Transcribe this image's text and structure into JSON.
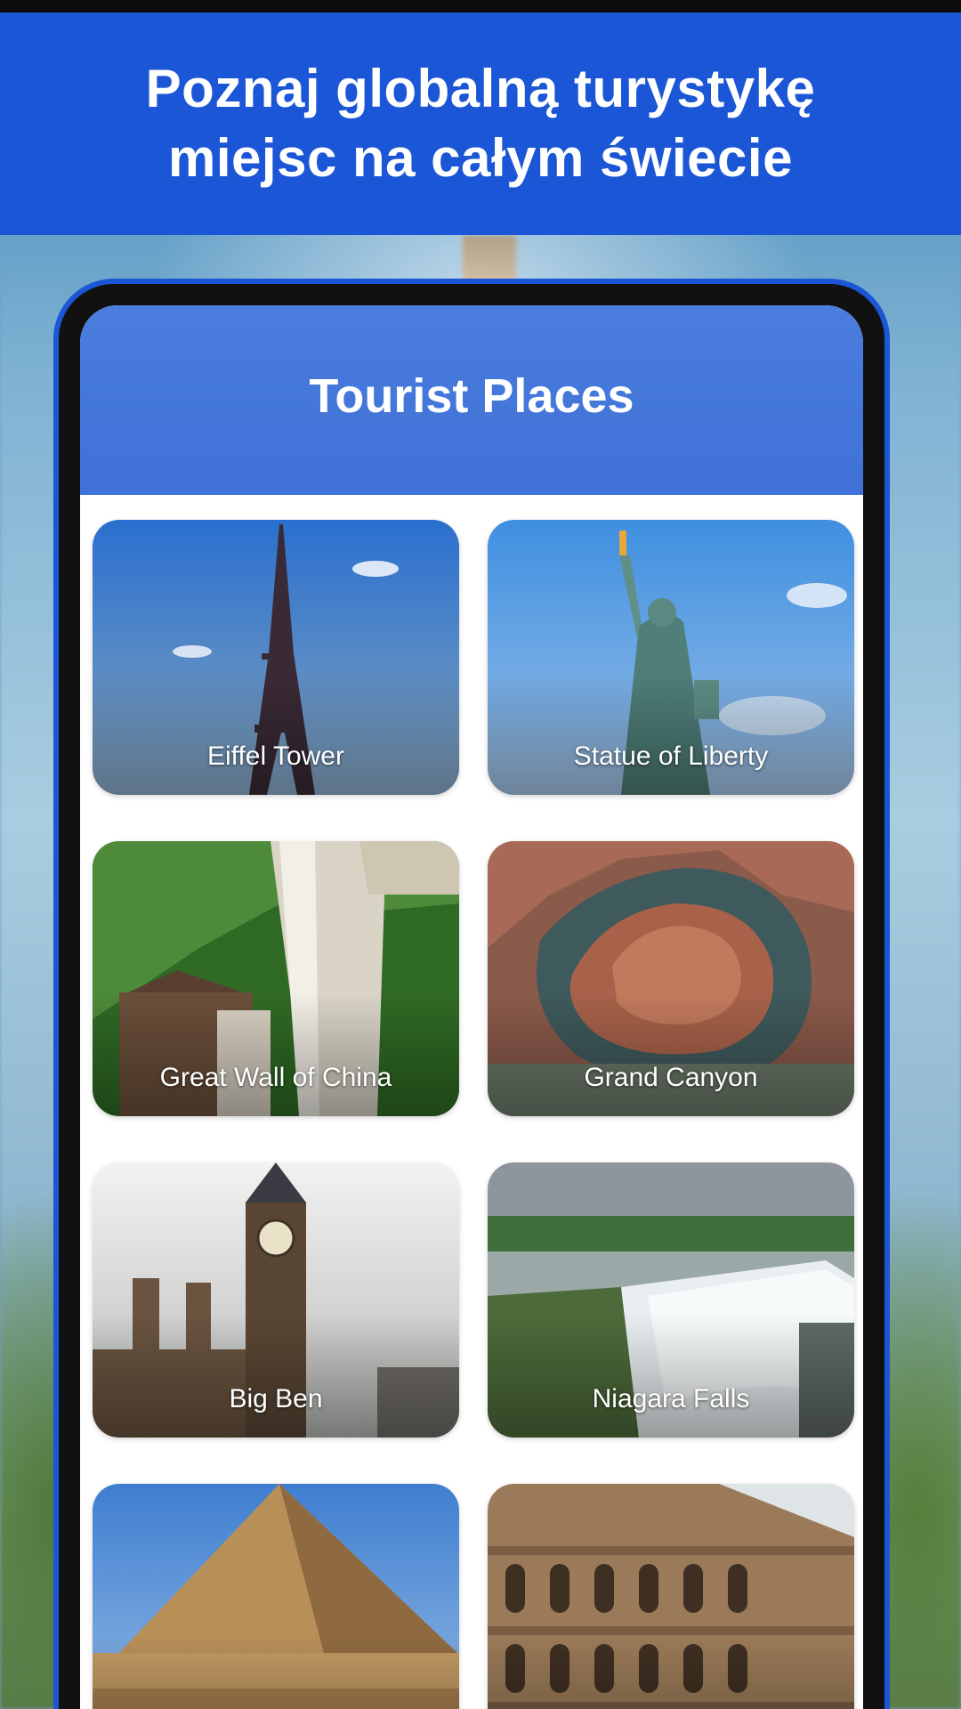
{
  "banner": {
    "title": "Poznaj globalną turystykę\nmiejsc na całym świecie"
  },
  "app": {
    "title": "Tourist Places"
  },
  "places": [
    {
      "label": "Eiffel Tower"
    },
    {
      "label": "Statue of Liberty"
    },
    {
      "label": "Great Wall of China"
    },
    {
      "label": "Grand Canyon"
    },
    {
      "label": "Big Ben"
    },
    {
      "label": "Niagara Falls"
    },
    {
      "label": ""
    },
    {
      "label": ""
    }
  ],
  "colors": {
    "banner": "#1b56d6",
    "app_header": "#4a7ddd",
    "phone_frame": "#111111"
  }
}
